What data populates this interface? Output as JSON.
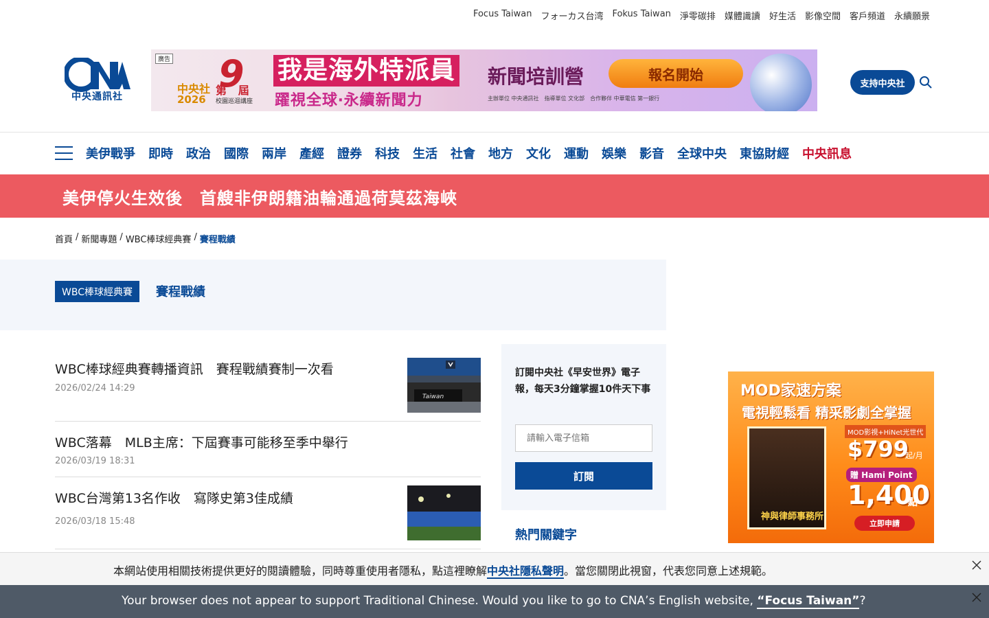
{
  "top_links": [
    "Focus Taiwan",
    "フォーカス台湾",
    "Fokus Taiwan",
    "淨零碳排",
    "媒體識讀",
    "好生活",
    "影像空間",
    "客戶頻道",
    "永續願景"
  ],
  "logo": {
    "text": "中央通訊社"
  },
  "banner_ad": {
    "tag": "廣告",
    "org": "中央社",
    "year": "2026",
    "edition_num": "9",
    "edition_prefix": "第",
    "edition_suffix": "屆",
    "sub": "校園巡迴講座",
    "title": "我是海外特派員",
    "camp": "新聞培訓營",
    "slogan": "躍視全球‧永續新聞力",
    "button": "報名開始",
    "sponsors": "主辦單位 中央通訊社　指導單位 文化部　合作夥伴 中華電信 第一銀行"
  },
  "header": {
    "support_button": "支持中央社"
  },
  "nav": {
    "items": [
      "美伊戰爭",
      "即時",
      "政治",
      "國際",
      "兩岸",
      "產經",
      "證券",
      "科技",
      "生活",
      "社會",
      "地方",
      "文化",
      "運動",
      "娛樂",
      "影音",
      "全球中央",
      "東協財經"
    ],
    "highlight_item": "中央訊息"
  },
  "breaking": {
    "headline": "美伊停火生效後　首艘非伊朗籍油輪通過荷莫茲海峽"
  },
  "breadcrumb": {
    "home": "首頁",
    "sep": "/",
    "level1": "新聞專題",
    "level2": "WBC棒球經典賽",
    "current": "賽程戰績"
  },
  "topic": {
    "tag": "WBC棒球經典賽",
    "name": "賽程戰績"
  },
  "articles": [
    {
      "title": "WBC棒球經典賽轉播資訊　賽程戰績賽制一次看",
      "date": "2026/02/24 14:29"
    },
    {
      "title": "WBC落幕　MLB主席：下屆賽事可能移至季中舉行",
      "date": "2026/03/19 18:31"
    },
    {
      "title": "WBC台灣第13名作收　寫隊史第3佳成績",
      "date": "2026/03/18 15:48"
    }
  ],
  "subscribe": {
    "description": "訂閱中央社《早安世界》電子報，每天3分鐘掌握10件天下事",
    "placeholder": "請輸入電子信箱",
    "button": "訂閱"
  },
  "hot_keywords": {
    "title": "熱門關鍵字"
  },
  "side_ad": {
    "brand": "MOD家速方案",
    "tagline": "電視輕鬆看 精采影劇全掌握",
    "plan": "MOD影視+HiNet光世代",
    "price": "$799",
    "price_unit": "起/月",
    "gift": "贈 Hami Point",
    "points": "1,400",
    "points_unit": "點",
    "poster_title": "神與律師事務所",
    "cta": "立即申請"
  },
  "cookie_bar": {
    "text_before": "本網站使用相關技術提供更好的閱讀體驗，同時尊重使用者隱私，點這裡瞭解",
    "link": "中央社隱私聲明",
    "text_after": "。當您關閉此視窗，代表您同意上述規範。"
  },
  "lang_bar": {
    "text_before": "Your browser does not appear to support Traditional Chinese. Would you like to go to CNA’s English website, ",
    "link": "“Focus Taiwan”",
    "text_after": "?"
  },
  "colors": {
    "brand_blue": "#0a4a96",
    "breaking_red": "#ec5a60",
    "nav_red": "#c8102e"
  }
}
